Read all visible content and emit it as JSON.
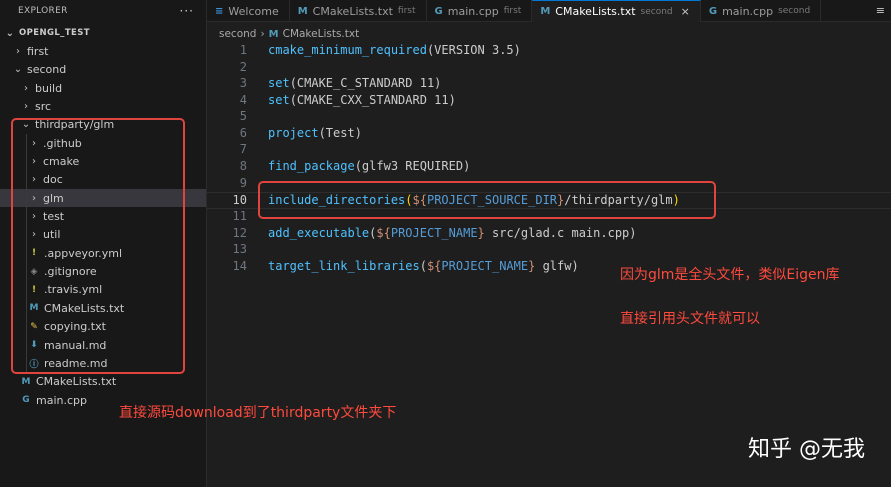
{
  "explorer": {
    "title": "EXPLORER",
    "more_label": "···",
    "root": "OPENGL_TEST",
    "items": [
      {
        "label": "first",
        "type": "folder",
        "depth": 1,
        "expanded": false
      },
      {
        "label": "second",
        "type": "folder",
        "depth": 1,
        "expanded": true
      },
      {
        "label": "build",
        "type": "folder",
        "depth": 2,
        "expanded": false
      },
      {
        "label": "src",
        "type": "folder",
        "depth": 2,
        "expanded": false
      },
      {
        "label": "thirdparty/glm",
        "type": "folder",
        "depth": 2,
        "expanded": true
      },
      {
        "label": ".github",
        "type": "folder",
        "depth": 3,
        "expanded": false
      },
      {
        "label": "cmake",
        "type": "folder",
        "depth": 3,
        "expanded": false
      },
      {
        "label": "doc",
        "type": "folder",
        "depth": 3,
        "expanded": false
      },
      {
        "label": "glm",
        "type": "folder",
        "depth": 3,
        "expanded": false,
        "selected": true
      },
      {
        "label": "test",
        "type": "folder",
        "depth": 3,
        "expanded": false
      },
      {
        "label": "util",
        "type": "folder",
        "depth": 3,
        "expanded": false
      },
      {
        "label": ".appveyor.yml",
        "type": "file",
        "depth": 3,
        "icon": "!",
        "icon_color": "#cbcb41"
      },
      {
        "label": ".gitignore",
        "type": "file",
        "depth": 3,
        "icon": "◈",
        "icon_color": "#8a8a8a"
      },
      {
        "label": ".travis.yml",
        "type": "file",
        "depth": 3,
        "icon": "!",
        "icon_color": "#cbcb41"
      },
      {
        "label": "CMakeLists.txt",
        "type": "file",
        "depth": 3,
        "icon": "M",
        "icon_color": "#519aba"
      },
      {
        "label": "copying.txt",
        "type": "file",
        "depth": 3,
        "icon": "✎",
        "icon_color": "#e7c547"
      },
      {
        "label": "manual.md",
        "type": "file",
        "depth": 3,
        "icon": "⬇",
        "icon_color": "#519aba"
      },
      {
        "label": "readme.md",
        "type": "file",
        "depth": 3,
        "icon": "ⓘ",
        "icon_color": "#519aba"
      },
      {
        "label": "CMakeLists.txt",
        "type": "file",
        "depth": 2,
        "icon": "M",
        "icon_color": "#519aba"
      },
      {
        "label": "main.cpp",
        "type": "file",
        "depth": 2,
        "icon": "G",
        "icon_color": "#519aba"
      }
    ]
  },
  "tabs": [
    {
      "label": "Welcome",
      "sub": "",
      "icon": "≡",
      "icon_color": "#3c8fd6",
      "active": false
    },
    {
      "label": "CMakeLists.txt",
      "sub": "first",
      "icon": "M",
      "icon_color": "#519aba",
      "active": false
    },
    {
      "label": "main.cpp",
      "sub": "first",
      "icon": "G",
      "icon_color": "#519aba",
      "active": false
    },
    {
      "label": "CMakeLists.txt",
      "sub": "second",
      "icon": "M",
      "icon_color": "#519aba",
      "active": true
    },
    {
      "label": "main.cpp",
      "sub": "second",
      "icon": "G",
      "icon_color": "#519aba",
      "active": false
    }
  ],
  "tab_close": "×",
  "tab_overflow": "≡",
  "breadcrumb": {
    "folder": "second",
    "sep": "›",
    "file_icon": "M",
    "file": "CMakeLists.txt"
  },
  "editor": {
    "current_line": 10,
    "lines": [
      {
        "n": "1",
        "tokens": [
          [
            "fn",
            "cmake_minimum_required"
          ],
          [
            "pl",
            "(VERSION 3.5)"
          ]
        ]
      },
      {
        "n": "2",
        "tokens": []
      },
      {
        "n": "3",
        "tokens": [
          [
            "fn",
            "set"
          ],
          [
            "pl",
            "(CMAKE_C_STANDARD 11)"
          ]
        ]
      },
      {
        "n": "4",
        "tokens": [
          [
            "fn",
            "set"
          ],
          [
            "pl",
            "(CMAKE_CXX_STANDARD 11)"
          ]
        ]
      },
      {
        "n": "5",
        "tokens": []
      },
      {
        "n": "6",
        "tokens": [
          [
            "fn",
            "project"
          ],
          [
            "pl",
            "(Test)"
          ]
        ]
      },
      {
        "n": "7",
        "tokens": []
      },
      {
        "n": "8",
        "tokens": [
          [
            "fn",
            "find_package"
          ],
          [
            "pl",
            "(glfw3 REQUIRED)"
          ]
        ]
      },
      {
        "n": "9",
        "tokens": []
      },
      {
        "n": "10",
        "tokens": [
          [
            "fn",
            "include_directories"
          ],
          [
            "paren",
            "("
          ],
          [
            "dl",
            "${"
          ],
          [
            "var",
            "PROJECT_SOURCE_DIR"
          ],
          [
            "dl",
            "}"
          ],
          [
            "pl",
            "/thirdparty/glm"
          ],
          [
            "paren",
            ")"
          ]
        ]
      },
      {
        "n": "11",
        "tokens": []
      },
      {
        "n": "12",
        "tokens": [
          [
            "fn",
            "add_executable"
          ],
          [
            "pl",
            "("
          ],
          [
            "dl",
            "${"
          ],
          [
            "var",
            "PROJECT_NAME"
          ],
          [
            "dl",
            "}"
          ],
          [
            "pl",
            " src/glad.c main.cpp)"
          ]
        ]
      },
      {
        "n": "13",
        "tokens": []
      },
      {
        "n": "14",
        "tokens": [
          [
            "fn",
            "target_link_libraries"
          ],
          [
            "pl",
            "("
          ],
          [
            "dl",
            "${"
          ],
          [
            "var",
            "PROJECT_NAME"
          ],
          [
            "dl",
            "}"
          ],
          [
            "pl",
            " glfw)"
          ]
        ]
      }
    ]
  },
  "annotations": {
    "note_header_only": "因为glm是全头文件，类似Eigen库",
    "note_include": "直接引用头文件就可以",
    "note_download": "直接源码download到了thirdparty文件夹下",
    "color": "#e0443e"
  },
  "watermark": "知乎 @无我"
}
